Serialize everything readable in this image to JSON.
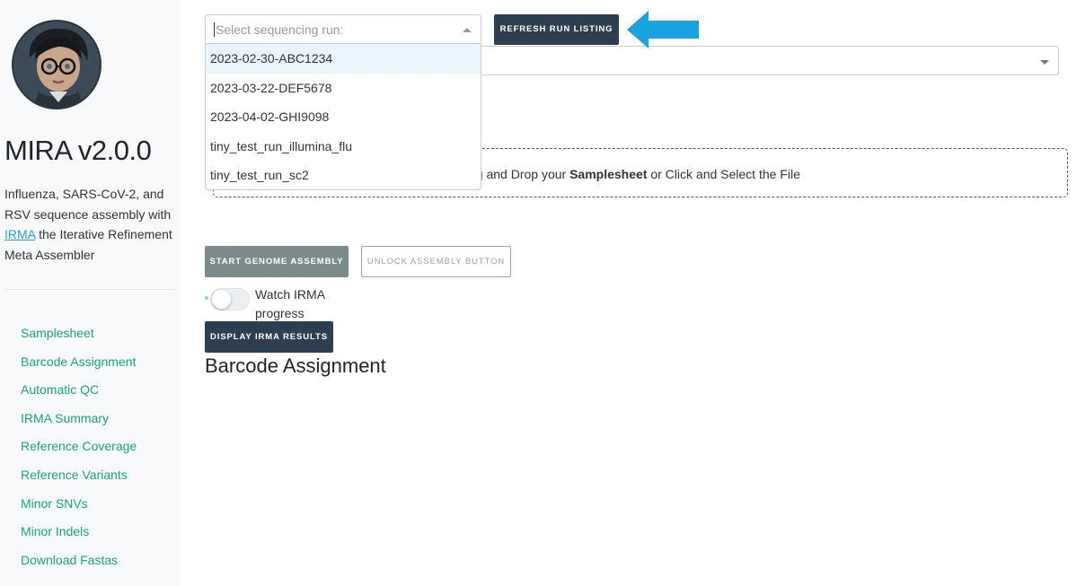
{
  "sidebar": {
    "app_title": "MIRA v2.0.0",
    "description": {
      "before_link": "Influenza, SARS-CoV-2, and RSV sequence assembly with ",
      "link_text": "IRMA",
      "after_link": " the Iterative Refinement Meta Assembler"
    },
    "nav_items": [
      {
        "label": "Samplesheet"
      },
      {
        "label": "Barcode Assignment"
      },
      {
        "label": "Automatic QC"
      },
      {
        "label": "IRMA Summary"
      },
      {
        "label": "Reference Coverage"
      },
      {
        "label": "Reference Variants"
      },
      {
        "label": "Minor SNVs"
      },
      {
        "label": "Minor Indels"
      },
      {
        "label": "Download Fastas"
      }
    ]
  },
  "run_select": {
    "placeholder": "Select sequencing run:",
    "options": [
      {
        "label": "2023-02-30-ABC1234"
      },
      {
        "label": "2023-03-22-DEF5678"
      },
      {
        "label": "2023-04-02-GHI9098"
      },
      {
        "label": "tiny_test_run_illumina_flu"
      },
      {
        "label": "tiny_test_run_sc2"
      }
    ]
  },
  "buttons": {
    "refresh": "Refresh Run Listing",
    "start_assembly": "Start Genome Assembly",
    "unlock_assembly": "Unlock Assembly Button",
    "display_results": "Display IRMA Results"
  },
  "upload": {
    "before": "ag and Drop your ",
    "bold": "Samplesheet",
    "after": " or Click and Select the File"
  },
  "toggle": {
    "label": "Watch IRMA progress",
    "checked": false
  },
  "section_heading": "Barcode Assignment",
  "icons": {
    "annotation_arrow": "arrow-left-icon",
    "caret": "caret-icon"
  },
  "colors": {
    "nav_link": "#1aa37a",
    "dark_button": "#2c3e50",
    "annotation_arrow": "#1aa3e0",
    "link": "#2a9fd6"
  }
}
